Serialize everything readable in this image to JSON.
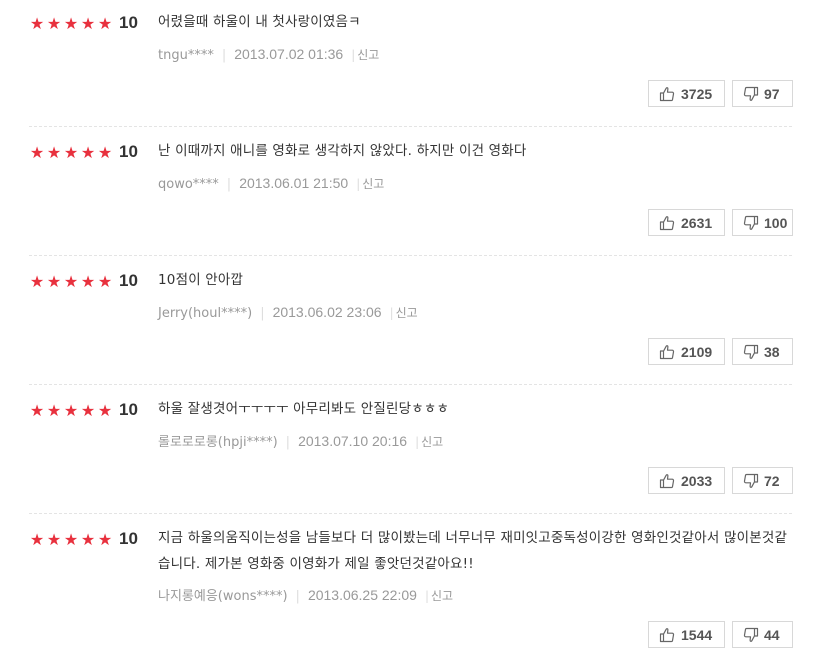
{
  "reviews": [
    {
      "stars": 5,
      "score": "10",
      "text": "어렸을때 하울이 내 첫사랑이였음ㅋ",
      "user": "tngu****",
      "date": "2013.07.02 01:36",
      "report_label": "신고",
      "likes": "3725",
      "dislikes": "97"
    },
    {
      "stars": 5,
      "score": "10",
      "text": "난 이때까지 애니를 영화로 생각하지 않았다. 하지만 이건 영화다",
      "user": "qowo****",
      "date": "2013.06.01 21:50",
      "report_label": "신고",
      "likes": "2631",
      "dislikes": "100"
    },
    {
      "stars": 5,
      "score": "10",
      "text": "10점이 안아깝",
      "user": "Jerry(houl****)",
      "date": "2013.06.02 23:06",
      "report_label": "신고",
      "likes": "2109",
      "dislikes": "38"
    },
    {
      "stars": 5,
      "score": "10",
      "text": "하울 잘생겻어ㅜㅜㅜㅜ 아무리봐도 안질린당ㅎㅎㅎ",
      "user": "롤로로로롱(hpji****)",
      "date": "2013.07.10 20:16",
      "report_label": "신고",
      "likes": "2033",
      "dislikes": "72"
    },
    {
      "stars": 5,
      "score": "10",
      "text": "지금 하울의움직이는성을 남들보다 더 많이봤는데 너무너무 재미잇고중독성이강한 영화인것같아서 많이본것같습니다. 제가본 영화중 이영화가 제일 좋앗던것같아요!!",
      "user": "나지롱예응(wons****)",
      "date": "2013.06.25 22:09",
      "report_label": "신고",
      "likes": "1544",
      "dislikes": "44"
    }
  ]
}
